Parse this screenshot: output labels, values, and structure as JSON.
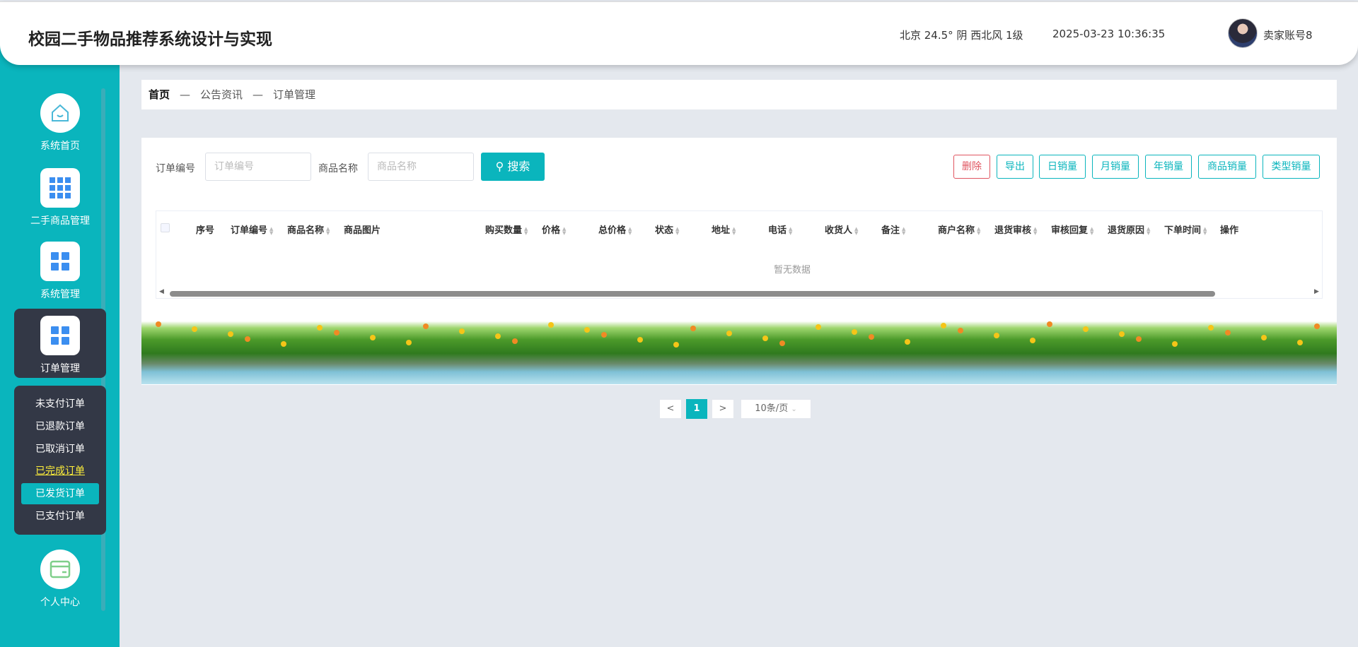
{
  "header": {
    "title": "校园二手物品推荐系统设计与实现",
    "weather": "北京  24.5°  阴  西北风  1级",
    "datetime": "2025-03-23 10:36:35",
    "username": "卖家账号8"
  },
  "sidebar": {
    "items": [
      {
        "label": "系统首页",
        "icon": "home-icon"
      },
      {
        "label": "二手商品管理",
        "icon": "grid-icon"
      },
      {
        "label": "系统管理",
        "icon": "grid-icon"
      },
      {
        "label": "订单管理",
        "icon": "grid-icon",
        "active": true
      },
      {
        "label": "个人中心",
        "icon": "card-icon"
      }
    ],
    "submenu": [
      {
        "label": "未支付订单"
      },
      {
        "label": "已退款订单"
      },
      {
        "label": "已取消订单"
      },
      {
        "label": "已完成订单",
        "hover": true
      },
      {
        "label": "已发货订单",
        "active": true
      },
      {
        "label": "已支付订单"
      }
    ]
  },
  "breadcrumb": [
    "首页",
    "公告资讯",
    "订单管理"
  ],
  "breadcrumb_sep": "—",
  "search": {
    "order_no_label": "订单编号",
    "order_no_placeholder": "订单编号",
    "product_label": "商品名称",
    "product_placeholder": "商品名称",
    "search_button": "搜索"
  },
  "actions": [
    "删除",
    "导出",
    "日销量",
    "月销量",
    "年销量",
    "商品销量",
    "类型销量"
  ],
  "table": {
    "columns": [
      "序号",
      "订单编号",
      "商品名称",
      "商品图片",
      "购买数量",
      "价格",
      "总价格",
      "状态",
      "地址",
      "电话",
      "收货人",
      "备注",
      "商户名称",
      "退货审核",
      "审核回复",
      "退货原因",
      "下单时间",
      "操作"
    ],
    "rows": [],
    "empty_text": "暂无数据"
  },
  "pagination": {
    "prev": "<",
    "current": "1",
    "next": ">",
    "page_size": "10条/页"
  },
  "colors": {
    "accent": "#0ab5bd",
    "sidebar_active": "#333846",
    "danger": "#e05560"
  }
}
